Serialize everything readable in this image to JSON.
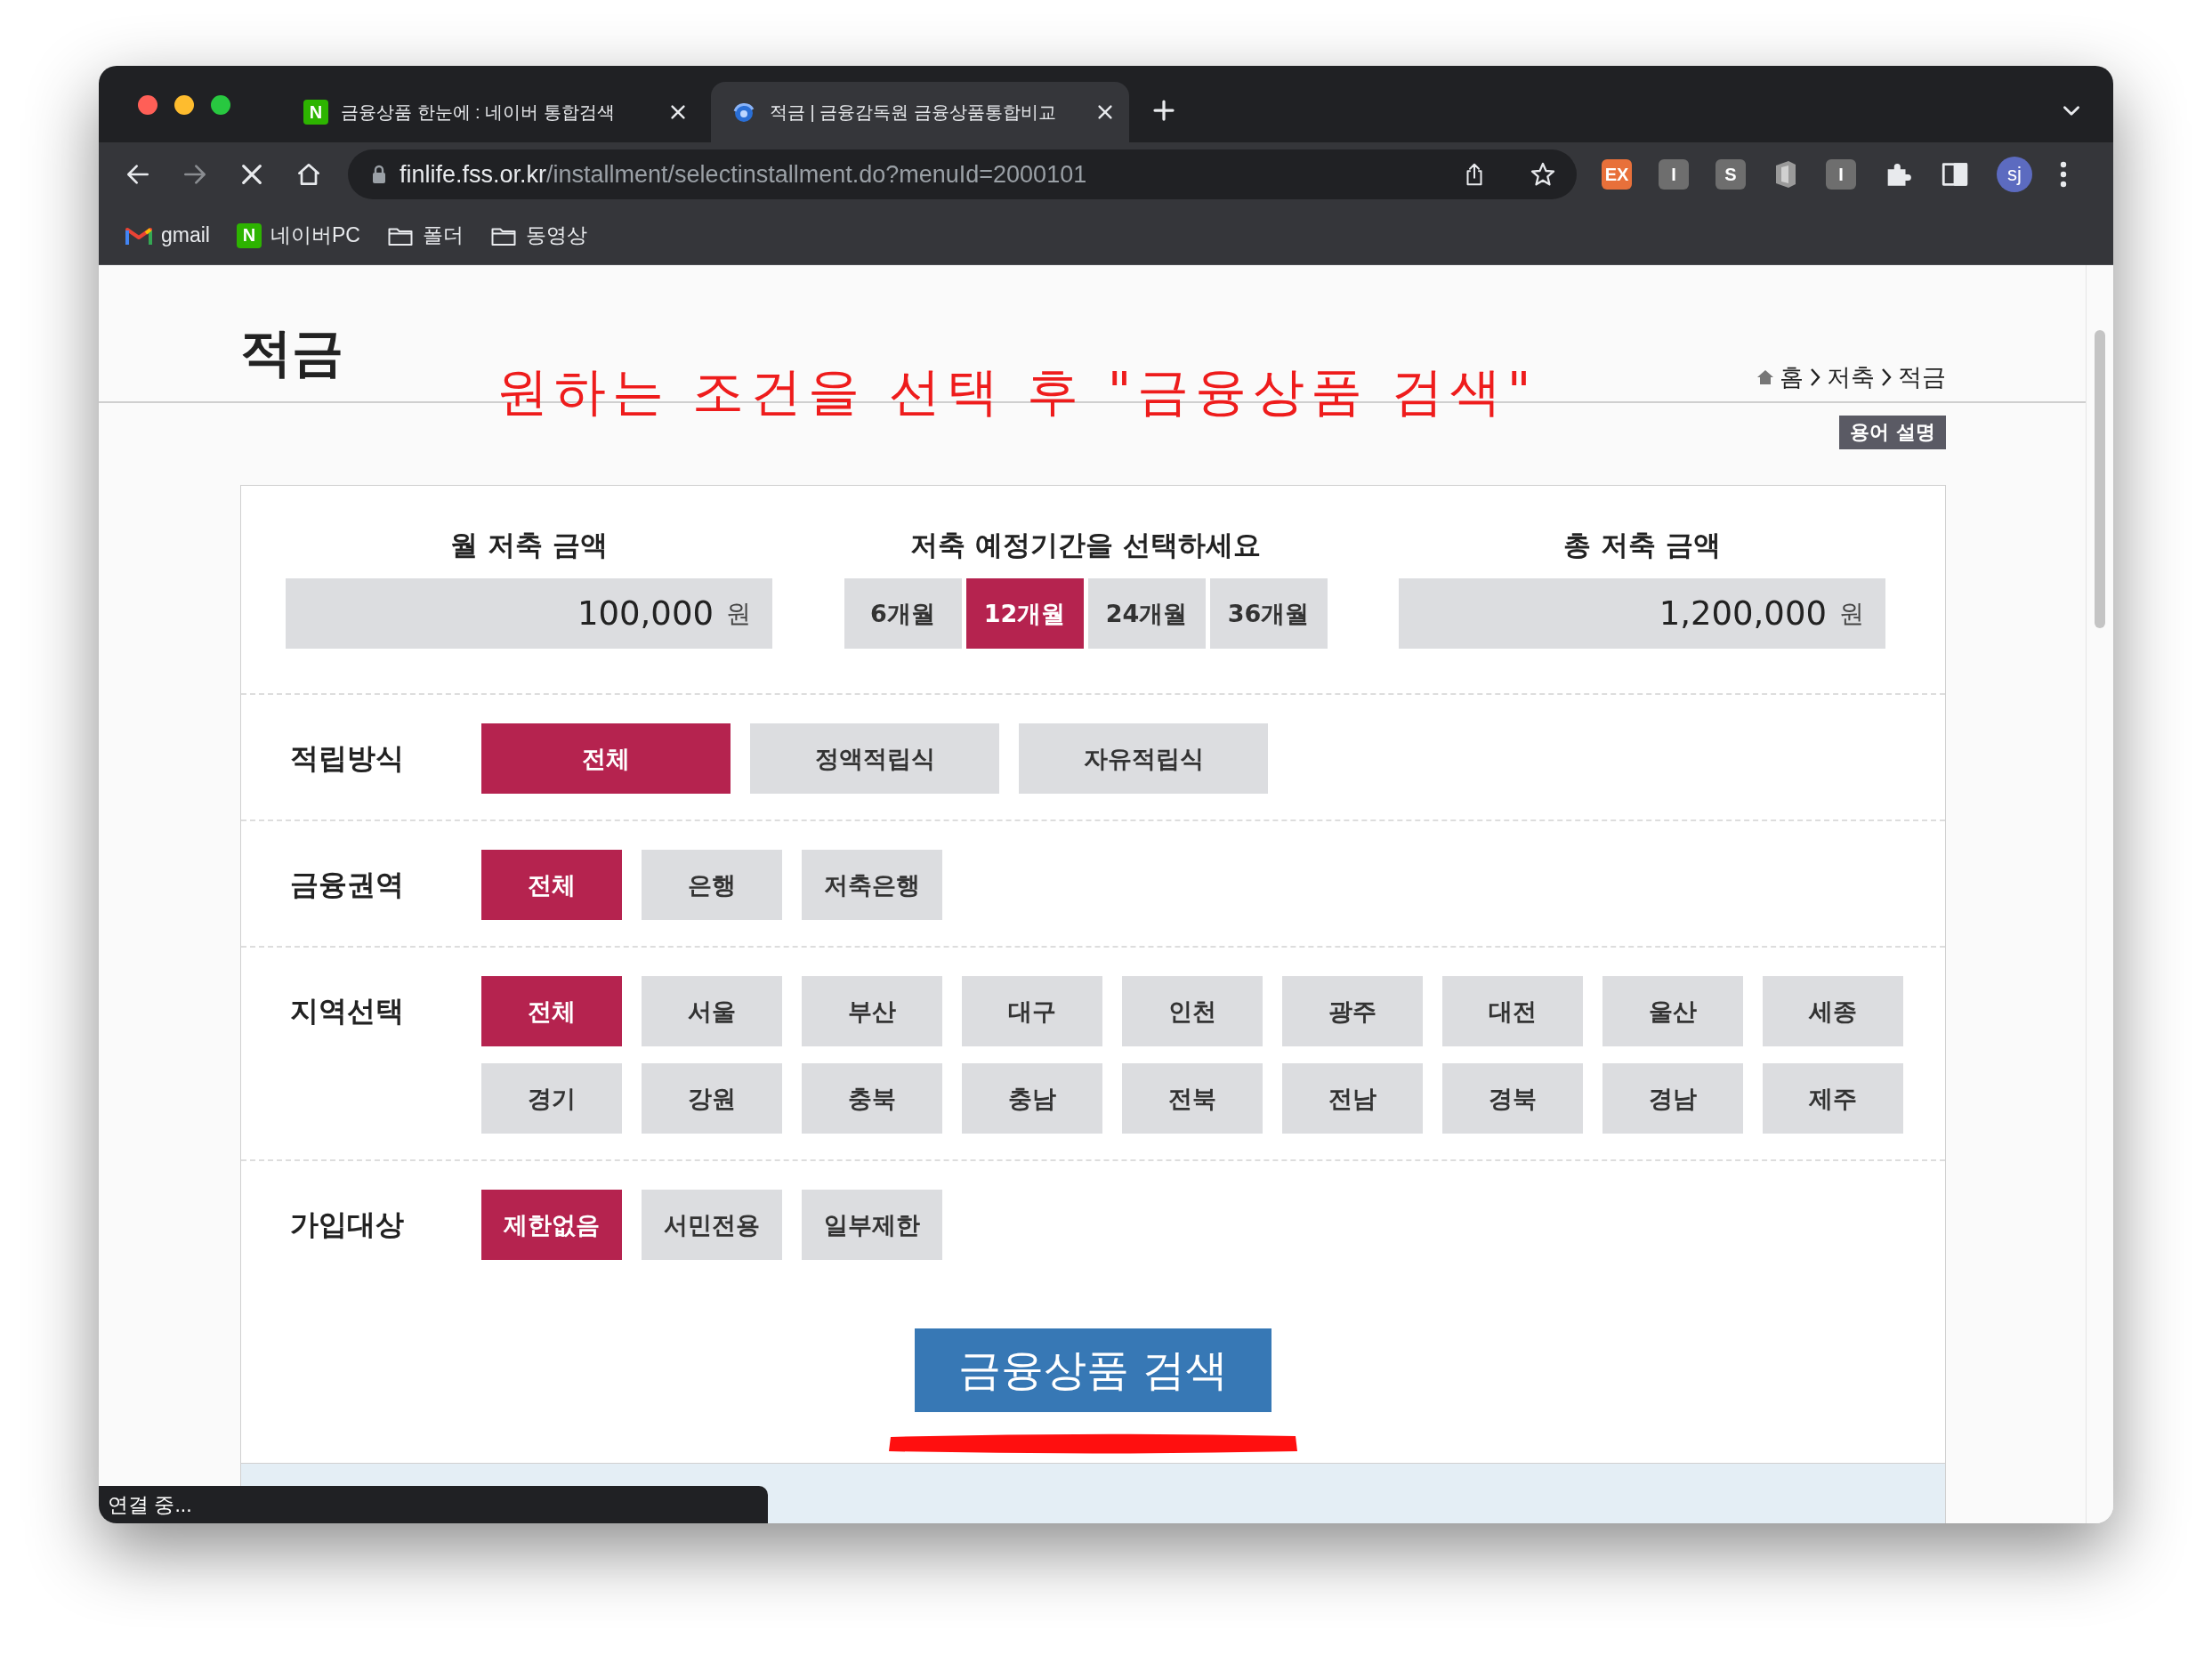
{
  "browser": {
    "tabs": [
      {
        "title": "금융상품 한눈에 : 네이버 통합검색",
        "selected": false,
        "favicon": {
          "kind": "letter",
          "label": "N"
        }
      },
      {
        "title": "적금 | 금융감독원 금융상품통합비교",
        "selected": true,
        "favicon": {
          "kind": "globe"
        }
      }
    ],
    "url": {
      "host": "finlife.fss.or.kr",
      "path": "/installment/selectinstallment.do?menuId=2000101"
    },
    "loading": true,
    "extensions": [
      {
        "kind": "letter",
        "label": "EX",
        "color": "#e8703a"
      },
      {
        "kind": "letter",
        "label": "I",
        "color": "#6e6e6e"
      },
      {
        "kind": "letter",
        "label": "S",
        "color": "#6e6e6e"
      },
      {
        "kind": "office"
      },
      {
        "kind": "letter",
        "label": "I",
        "color": "#6e6e6e"
      }
    ],
    "profile": "sj",
    "bookmarks": [
      {
        "kind": "mail",
        "label": "gmail"
      },
      {
        "kind": "letter",
        "icon_label": "N",
        "label": "네이버PC"
      },
      {
        "kind": "folder",
        "label": "폴더"
      },
      {
        "kind": "folder",
        "label": "동영상"
      }
    ],
    "status": "연결 중..."
  },
  "page": {
    "title": "적금",
    "annotation": "원하는 조건을 선택 후 \"금융상품 검색\"",
    "breadcrumb": [
      "홈",
      "저축",
      "적금"
    ],
    "glossary_button": "용어 설명",
    "monthly": {
      "label": "월 저축 금액",
      "value": "100,000",
      "unit": "원"
    },
    "period": {
      "label": "저축 예정기간을 선택하세요",
      "options": [
        {
          "label": "6개월",
          "selected": false
        },
        {
          "label": "12개월",
          "selected": true
        },
        {
          "label": "24개월",
          "selected": false
        },
        {
          "label": "36개월",
          "selected": false
        }
      ]
    },
    "total": {
      "label": "총 저축 금액",
      "value": "1,200,000",
      "unit": "원"
    },
    "filters": [
      {
        "label": "적립방식",
        "options": [
          {
            "label": "전체",
            "selected": true
          },
          {
            "label": "정액적립식",
            "selected": false
          },
          {
            "label": "자유적립식",
            "selected": false
          }
        ]
      },
      {
        "label": "금융권역",
        "options": [
          {
            "label": "전체",
            "selected": true
          },
          {
            "label": "은행",
            "selected": false
          },
          {
            "label": "저축은행",
            "selected": false
          }
        ]
      },
      {
        "label": "지역선택",
        "options": [
          {
            "label": "전체",
            "selected": true
          },
          {
            "label": "서울",
            "selected": false
          },
          {
            "label": "부산",
            "selected": false
          },
          {
            "label": "대구",
            "selected": false
          },
          {
            "label": "인천",
            "selected": false
          },
          {
            "label": "광주",
            "selected": false
          },
          {
            "label": "대전",
            "selected": false
          },
          {
            "label": "울산",
            "selected": false
          },
          {
            "label": "세종",
            "selected": false
          },
          {
            "label": "경기",
            "selected": false
          },
          {
            "label": "강원",
            "selected": false
          },
          {
            "label": "충북",
            "selected": false
          },
          {
            "label": "충남",
            "selected": false
          },
          {
            "label": "전북",
            "selected": false
          },
          {
            "label": "전남",
            "selected": false
          },
          {
            "label": "경북",
            "selected": false
          },
          {
            "label": "경남",
            "selected": false
          },
          {
            "label": "제주",
            "selected": false
          }
        ]
      },
      {
        "label": "가입대상",
        "options": [
          {
            "label": "제한없음",
            "selected": true
          },
          {
            "label": "서민전용",
            "selected": false
          },
          {
            "label": "일부제한",
            "selected": false
          }
        ]
      }
    ],
    "search_button": "금융상품 검색"
  }
}
